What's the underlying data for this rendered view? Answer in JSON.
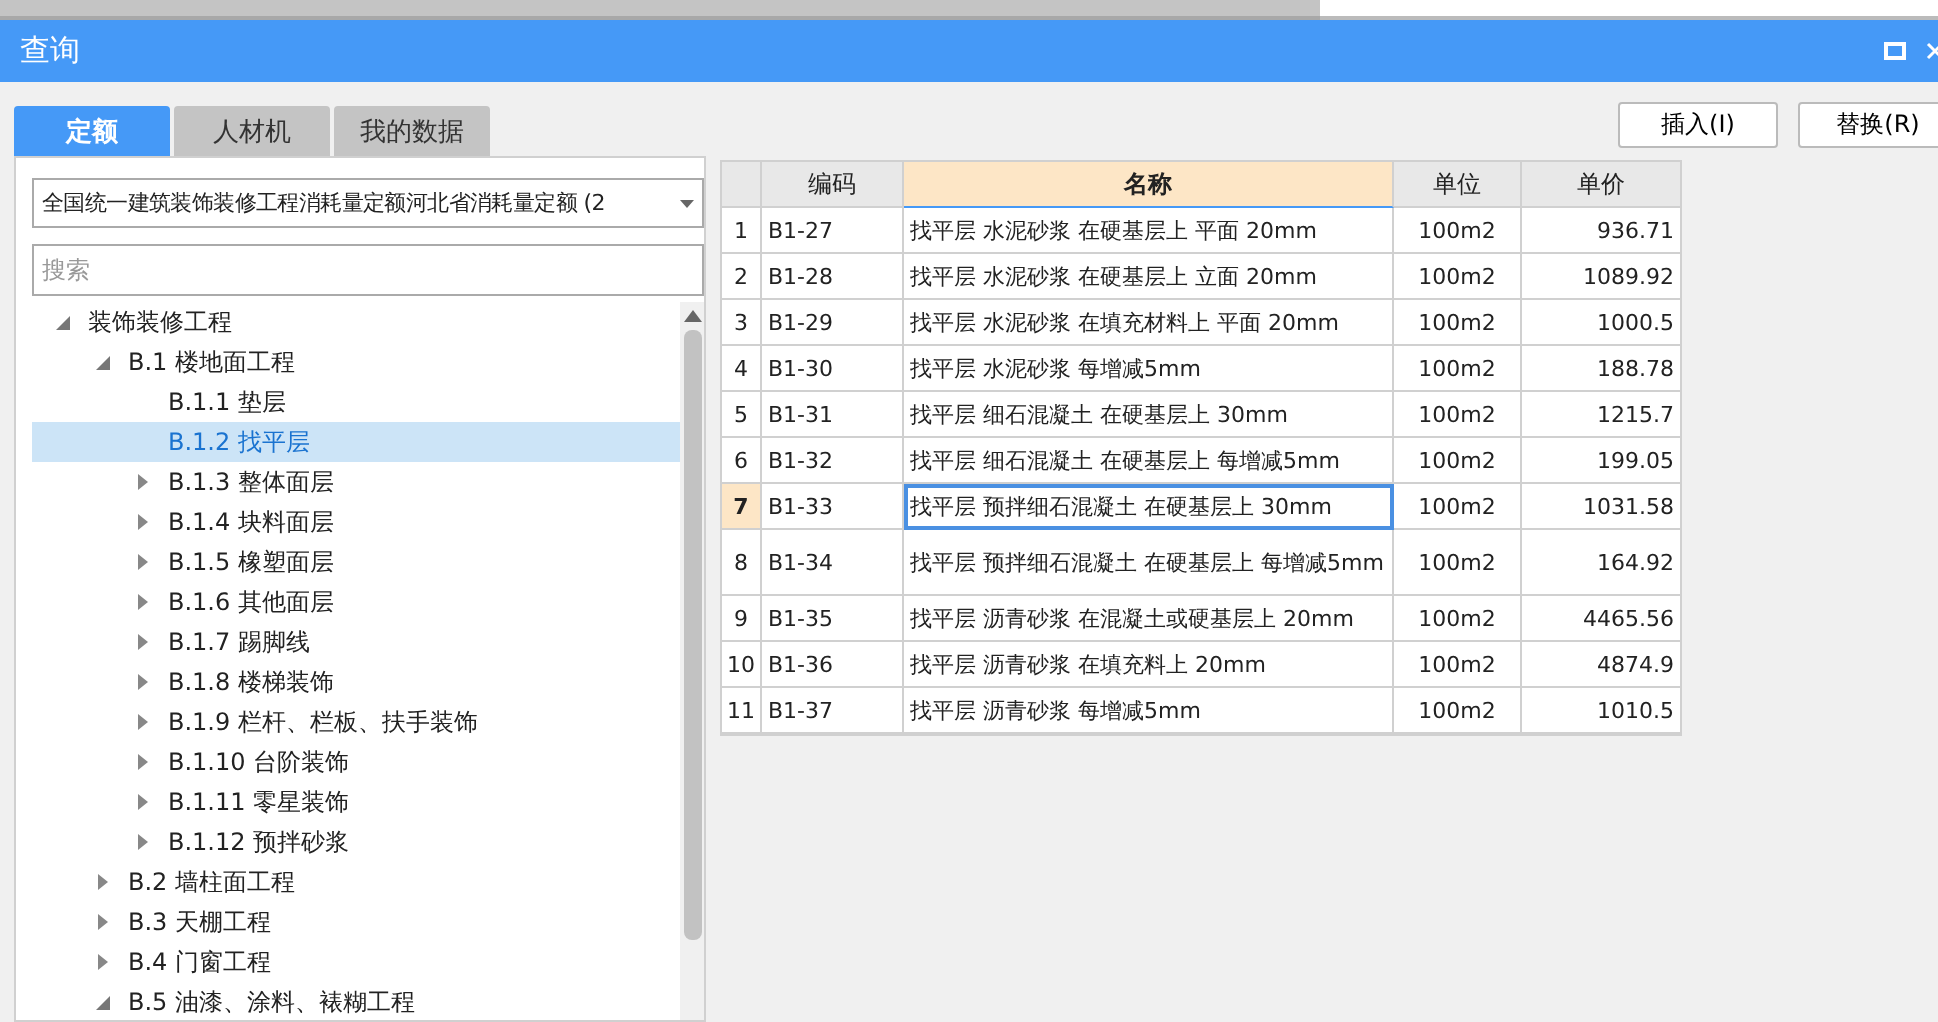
{
  "window": {
    "title": "查询"
  },
  "tabs": [
    {
      "label": "定额",
      "selected": true
    },
    {
      "label": "人材机",
      "selected": false
    },
    {
      "label": "我的数据",
      "selected": false
    }
  ],
  "library_select": {
    "value": "全国统一建筑装饰装修工程消耗量定额河北省消耗量定额 (2"
  },
  "search": {
    "placeholder": "搜索"
  },
  "tree": [
    {
      "label": "装饰装修工程",
      "expanded": true,
      "selected": false,
      "children": [
        {
          "label": "B.1 楼地面工程",
          "expanded": true,
          "selected": false,
          "children": [
            {
              "label": "B.1.1 垫层",
              "selected": false
            },
            {
              "label": "B.1.2 找平层",
              "selected": true
            },
            {
              "label": "B.1.3 整体面层",
              "expanded": false,
              "selected": false
            },
            {
              "label": "B.1.4 块料面层",
              "expanded": false,
              "selected": false
            },
            {
              "label": "B.1.5 橡塑面层",
              "expanded": false,
              "selected": false
            },
            {
              "label": "B.1.6 其他面层",
              "expanded": false,
              "selected": false
            },
            {
              "label": "B.1.7 踢脚线",
              "expanded": false,
              "selected": false
            },
            {
              "label": "B.1.8 楼梯装饰",
              "expanded": false,
              "selected": false
            },
            {
              "label": "B.1.9 栏杆、栏板、扶手装饰",
              "expanded": false,
              "selected": false
            },
            {
              "label": "B.1.10 台阶装饰",
              "expanded": false,
              "selected": false
            },
            {
              "label": "B.1.11 零星装饰",
              "expanded": false,
              "selected": false
            },
            {
              "label": "B.1.12 预拌砂浆",
              "expanded": false,
              "selected": false
            }
          ]
        },
        {
          "label": "B.2 墙柱面工程",
          "expanded": false,
          "selected": false
        },
        {
          "label": "B.3 天棚工程",
          "expanded": false,
          "selected": false
        },
        {
          "label": "B.4 门窗工程",
          "expanded": false,
          "selected": false
        },
        {
          "label": "B.5 油漆、涂料、裱糊工程",
          "expanded": true,
          "selected": false
        }
      ]
    }
  ],
  "buttons": [
    "插入(I)",
    "替换(R)"
  ],
  "table": {
    "columns": [
      "编码",
      "名称",
      "单位",
      "单价"
    ],
    "rows": [
      {
        "index": "1",
        "code": "B1-27",
        "name": "找平层 水泥砂浆 在硬基层上 平面 20mm",
        "unit": "100m2",
        "price": "936.71",
        "selected": false
      },
      {
        "index": "2",
        "code": "B1-28",
        "name": "找平层 水泥砂浆 在硬基层上 立面 20mm",
        "unit": "100m2",
        "price": "1089.92",
        "selected": false
      },
      {
        "index": "3",
        "code": "B1-29",
        "name": "找平层 水泥砂浆 在填充材料上 平面 20mm",
        "unit": "100m2",
        "price": "1000.5",
        "selected": false
      },
      {
        "index": "4",
        "code": "B1-30",
        "name": "找平层 水泥砂浆 每增减5mm",
        "unit": "100m2",
        "price": "188.78",
        "selected": false
      },
      {
        "index": "5",
        "code": "B1-31",
        "name": "找平层 细石混凝土 在硬基层上 30mm",
        "unit": "100m2",
        "price": "1215.7",
        "selected": false
      },
      {
        "index": "6",
        "code": "B1-32",
        "name": "找平层 细石混凝土 在硬基层上 每增减5mm",
        "unit": "100m2",
        "price": "199.05",
        "selected": false
      },
      {
        "index": "7",
        "code": "B1-33",
        "name": "找平层 预拌细石混凝土 在硬基层上 30mm",
        "unit": "100m2",
        "price": "1031.58",
        "selected": true
      },
      {
        "index": "8",
        "code": "B1-34",
        "name": "找平层 预拌细石混凝土 在硬基层上 每增减5mm",
        "unit": "100m2",
        "price": "164.92",
        "selected": false
      },
      {
        "index": "9",
        "code": "B1-35",
        "name": "找平层 沥青砂浆 在混凝土或硬基层上 20mm",
        "unit": "100m2",
        "price": "4465.56",
        "selected": false
      },
      {
        "index": "10",
        "code": "B1-36",
        "name": "找平层 沥青砂浆 在填充料上 20mm",
        "unit": "100m2",
        "price": "4874.9",
        "selected": false
      },
      {
        "index": "11",
        "code": "B1-37",
        "name": "找平层 沥青砂浆 每增减5mm",
        "unit": "100m2",
        "price": "1010.5",
        "selected": false
      }
    ]
  }
}
